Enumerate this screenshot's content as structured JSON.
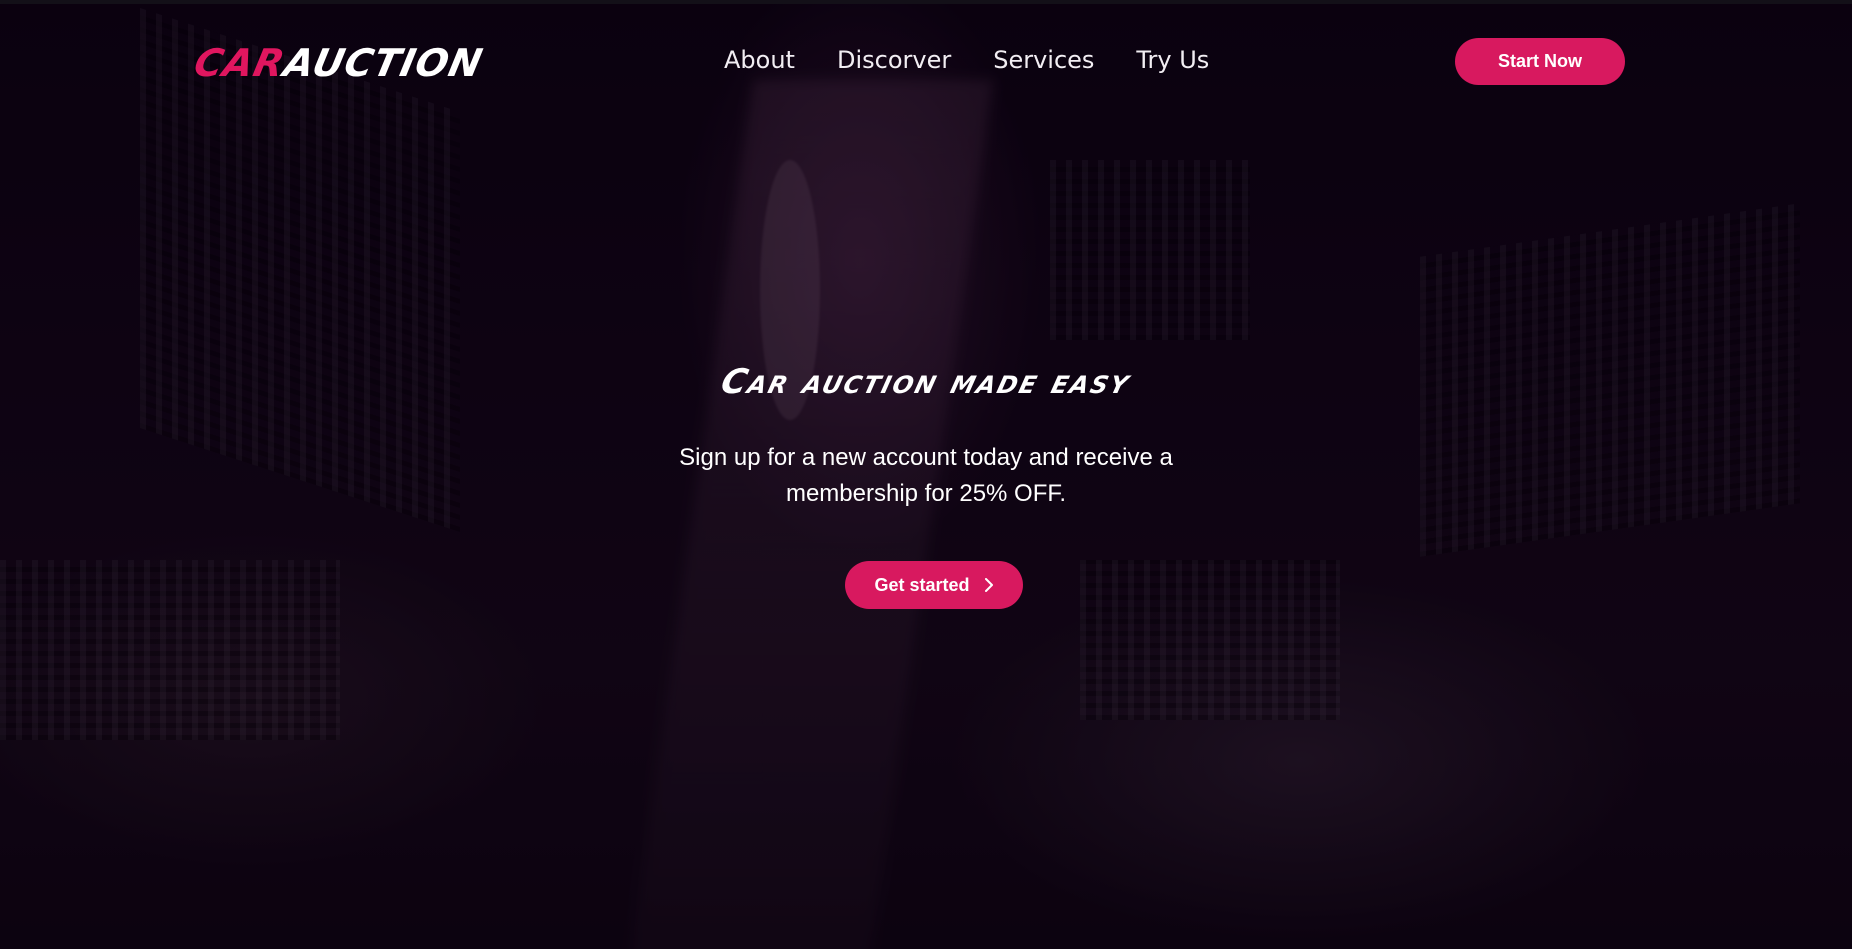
{
  "brand": {
    "part1": "CAR",
    "part2": "AUCTION",
    "accent_color": "#d8195f"
  },
  "nav": {
    "items": [
      {
        "label": "About"
      },
      {
        "label": "Discorver"
      },
      {
        "label": "Services"
      },
      {
        "label": "Try Us"
      }
    ]
  },
  "header": {
    "start_label": "Start Now"
  },
  "hero": {
    "title": "Car auction made easy",
    "subtitle": "Sign up for a new account today and receive a membership for 25% OFF.",
    "cta_label": "Get started",
    "cta_icon": "chevron-right-icon"
  }
}
